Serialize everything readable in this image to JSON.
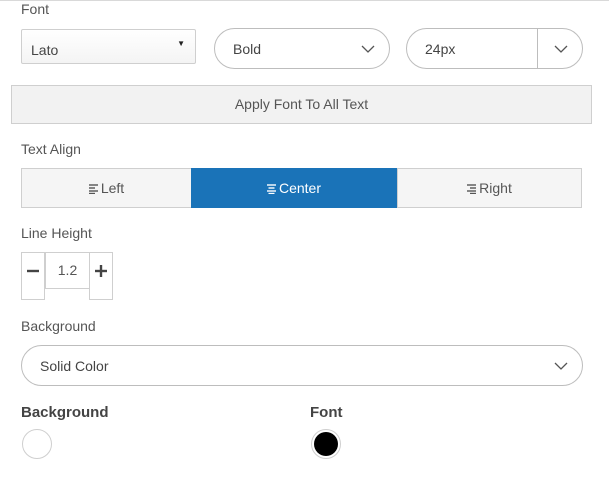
{
  "font": {
    "label": "Font",
    "family_value": "Lato",
    "weight_value": "Bold",
    "size_value": "24px"
  },
  "apply_button_label": "Apply Font To All Text",
  "text_align": {
    "label": "Text Align",
    "options": [
      "Left",
      "Center",
      "Right"
    ],
    "selected": "Center"
  },
  "line_height": {
    "label": "Line Height",
    "value": "1.2"
  },
  "background": {
    "label": "Background",
    "selected": "Solid Color"
  },
  "colors": {
    "background_label": "Background",
    "font_label": "Font",
    "background_color": "#ffffff",
    "font_color": "#000000"
  },
  "accent_color": "#1a73b8"
}
